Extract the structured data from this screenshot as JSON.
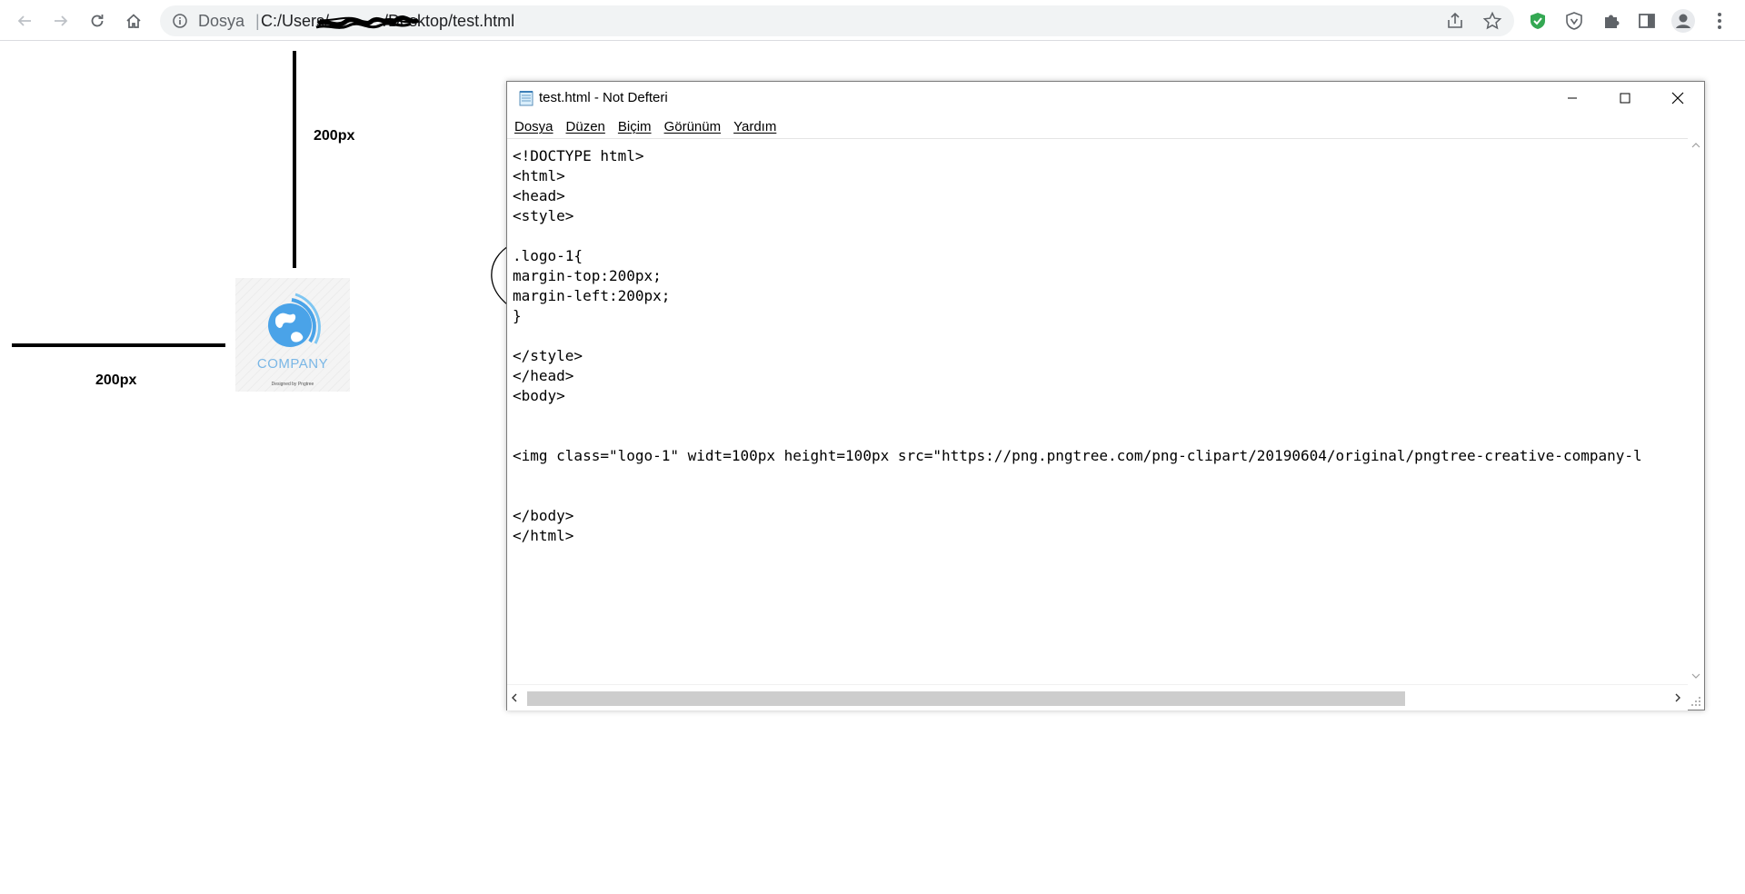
{
  "browser": {
    "scheme_label": "Dosya",
    "url": "C:/Users/            /Desktop/test.html"
  },
  "page": {
    "vertical_label": "200px",
    "horizontal_label": "200px",
    "logo_text": "COMPANY",
    "logo_subtext": "Designed by Pngtree"
  },
  "notepad": {
    "title": "test.html - Not Defteri",
    "menu": [
      "Dosya",
      "Düzen",
      "Biçim",
      "Görünüm",
      "Yardım"
    ],
    "code_lines": [
      "<!DOCTYPE html>",
      "<html>",
      "<head>",
      "<style>",
      "",
      ".logo-1{",
      "margin-top:200px;",
      "margin-left:200px;",
      "}",
      "",
      "</style>",
      "</head>",
      "<body>",
      "",
      "",
      "<img class=\"logo-1\" widt=100px height=100px src=\"https://png.pngtree.com/png-clipart/20190604/original/pngtree-creative-company-l",
      "",
      "",
      "</body>",
      "</html>"
    ]
  },
  "colors": {
    "shield_green": "#34a853",
    "logo_blue": "#4aa3e8"
  }
}
